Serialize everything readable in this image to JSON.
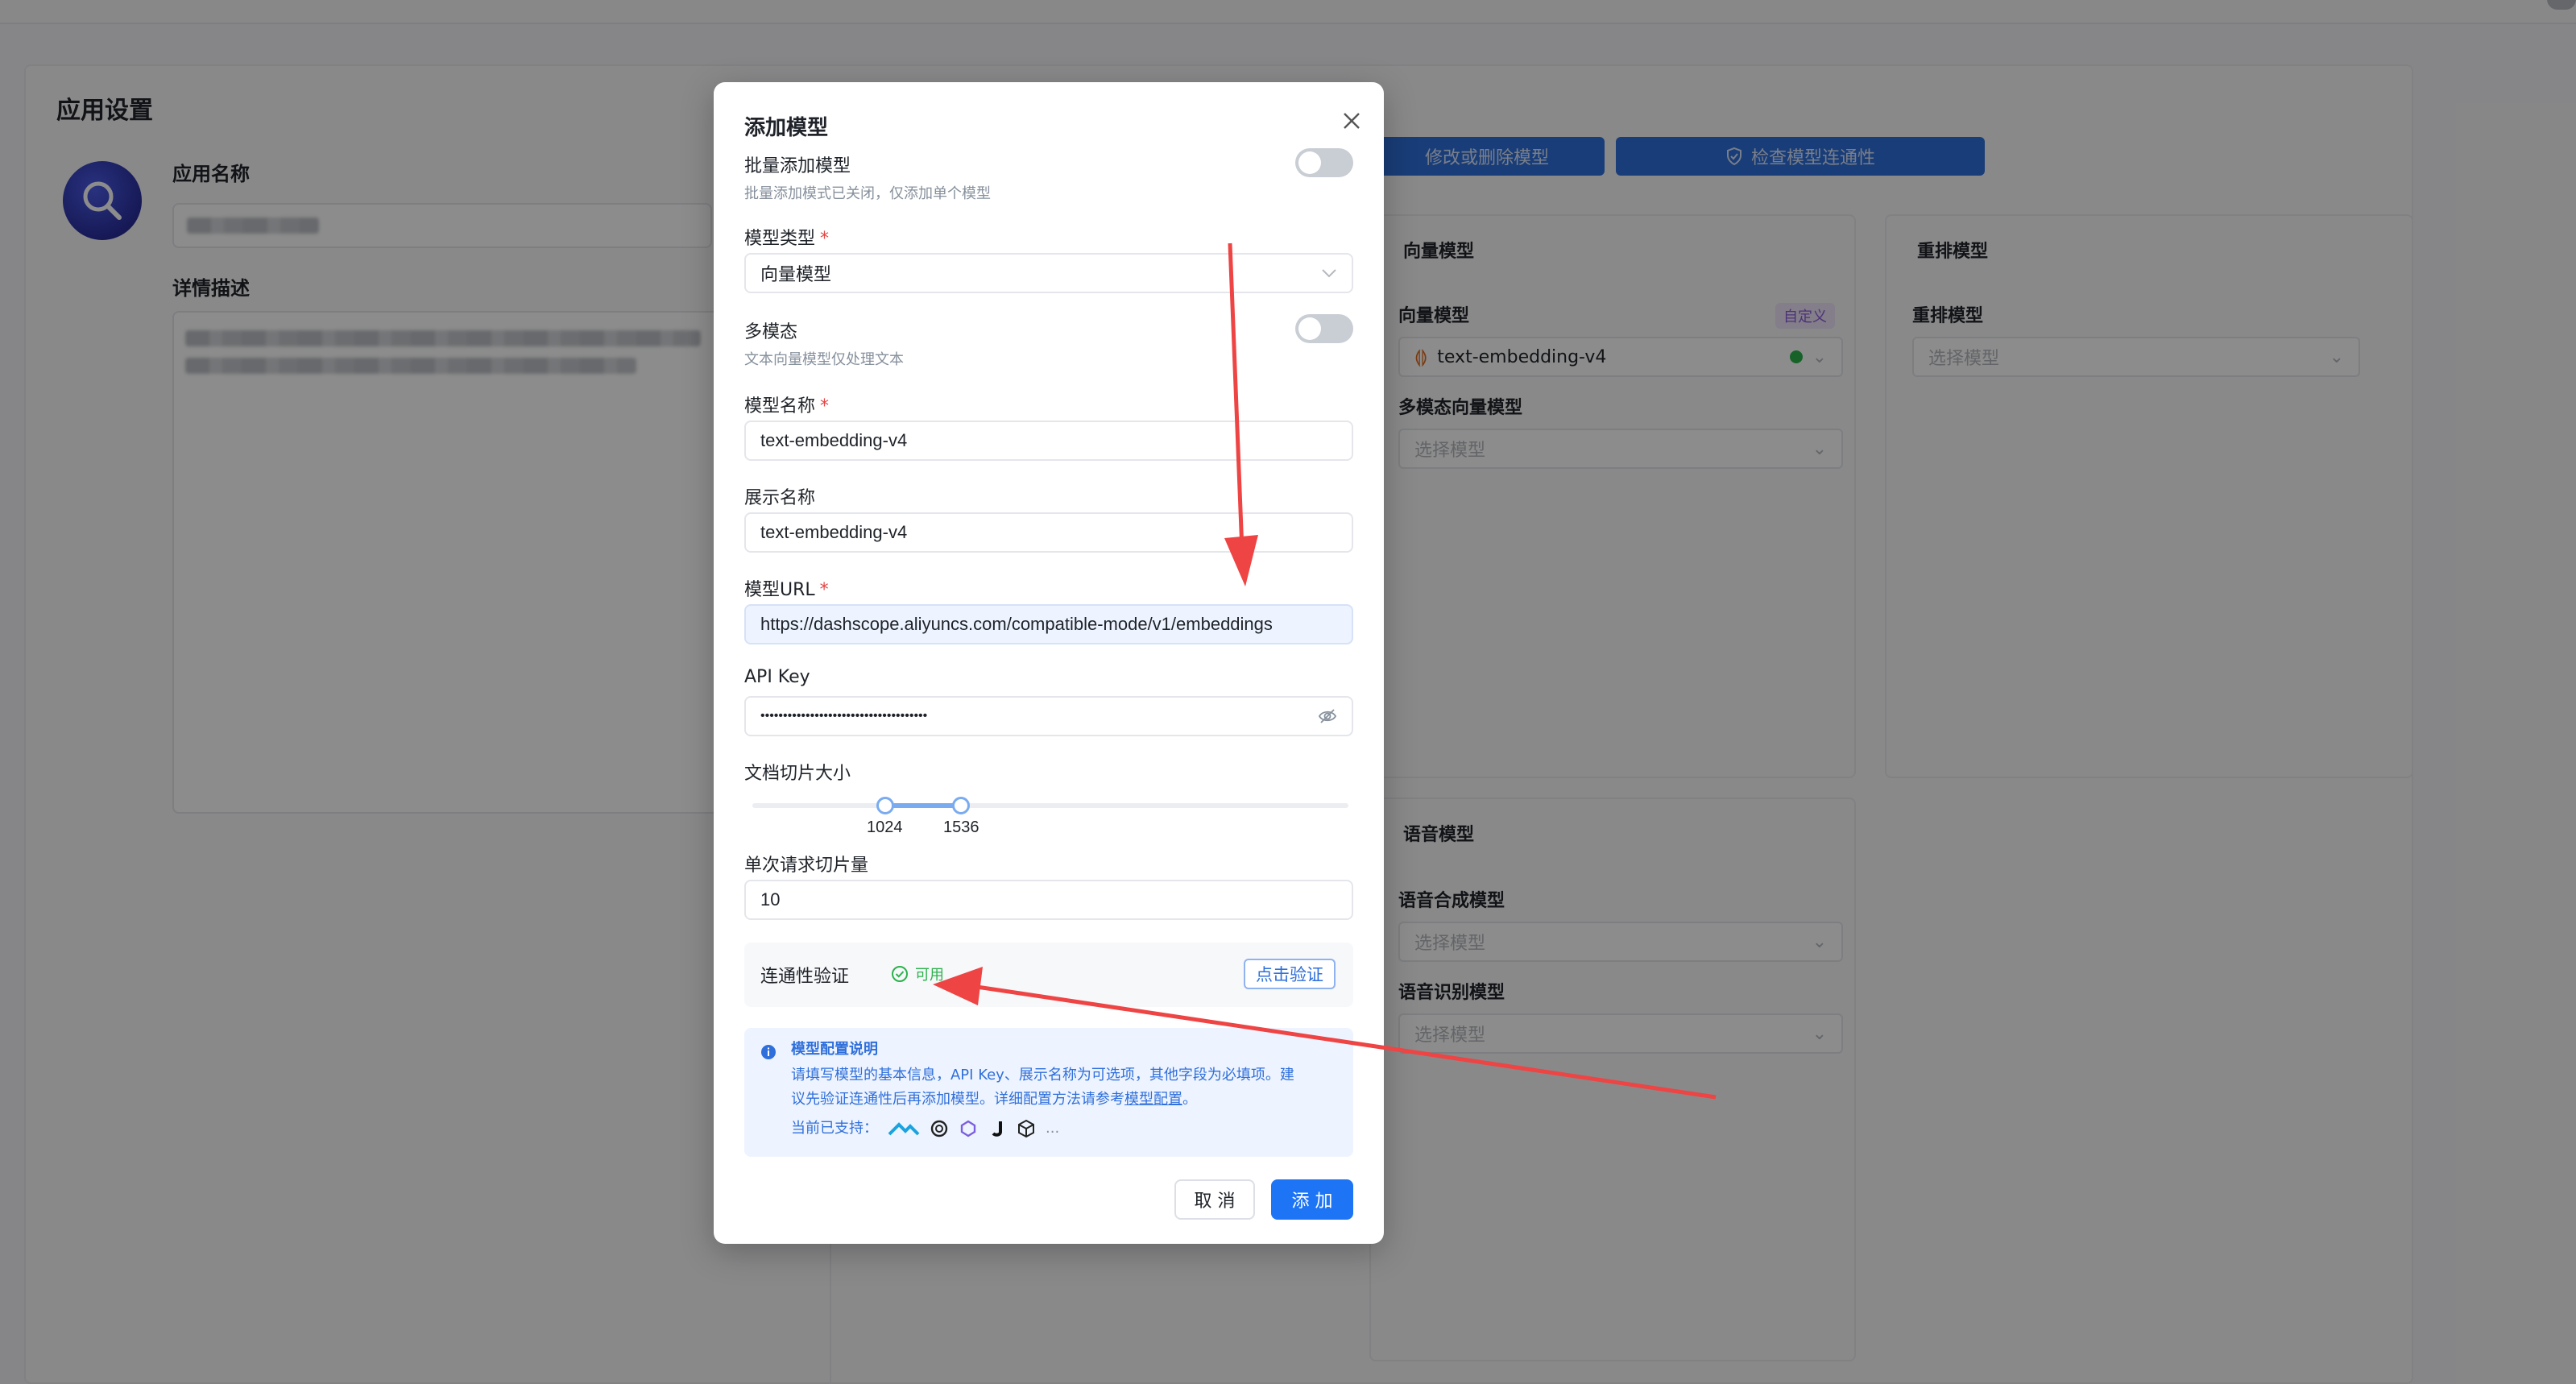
{
  "background": {
    "page_title": "应用设置",
    "app_name_label": "应用名称",
    "description_label": "详情描述",
    "buttons": {
      "edit_models": "修改或删除模型",
      "check_connectivity": "检查模型连通性"
    },
    "embedding_panel": {
      "title": "向量模型",
      "embedding_label": "向量模型",
      "custom_tag": "自定义",
      "embedding_value": "text-embedding-v4",
      "multimodal_label": "多模态向量模型",
      "multimodal_placeholder": "选择模型"
    },
    "rerank_panel": {
      "title": "重排模型",
      "rerank_label": "重排模型",
      "rerank_placeholder": "选择模型"
    },
    "voice_panel": {
      "title": "语音模型",
      "tts_label": "语音合成模型",
      "tts_placeholder": "选择模型",
      "asr_label": "语音识别模型",
      "asr_placeholder": "选择模型"
    }
  },
  "modal": {
    "title": "添加模型",
    "batch_add": {
      "label": "批量添加模型",
      "hint": "批量添加模式已关闭，仅添加单个模型",
      "enabled": false
    },
    "model_type": {
      "label": "模型类型",
      "value": "向量模型"
    },
    "multimodal": {
      "label": "多模态",
      "hint": "文本向量模型仅处理文本",
      "enabled": false
    },
    "model_name": {
      "label": "模型名称",
      "value": "text-embedding-v4"
    },
    "display_name": {
      "label": "展示名称",
      "value": "text-embedding-v4"
    },
    "model_url": {
      "label": "模型URL",
      "value": "https://dashscope.aliyuncs.com/compatible-mode/v1/embeddings"
    },
    "api_key": {
      "label": "API Key",
      "value": "•••••••••••••••••••••••••••••••••••••"
    },
    "chunk_size": {
      "label": "文档切片大小",
      "min": 1024,
      "max": 1536
    },
    "batch_chunks": {
      "label": "单次请求切片量",
      "value": "10"
    },
    "connectivity": {
      "label": "连通性验证",
      "status": "可用",
      "verify_button": "点击验证"
    },
    "info": {
      "title": "模型配置说明",
      "line1": "请填写模型的基本信息，API Key、展示名称为可选项，其他字段为必填项。建",
      "line2_prefix": "议先验证连通性后再添加模型。详细配置方法请参考",
      "line2_link": "模型配置",
      "line2_suffix": "。",
      "supported_label": "当前已支持：",
      "ellipsis": "..."
    },
    "cancel_button": "取 消",
    "add_button": "添 加"
  },
  "colors": {
    "primary": "#1d74f5",
    "success": "#2bb24c",
    "required": "#e54545",
    "annotation_arrow": "#ee4444"
  }
}
